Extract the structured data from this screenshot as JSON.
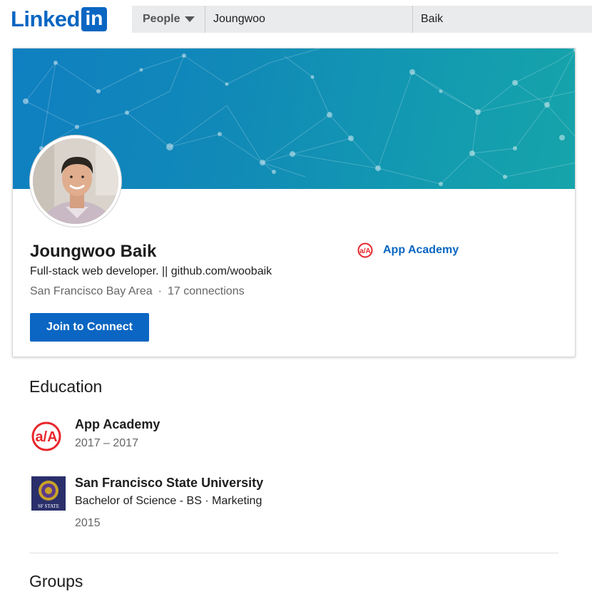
{
  "header": {
    "logo_text": "Linked",
    "logo_box_text": "in",
    "search_type": "People",
    "first_name_value": "Joungwoo",
    "last_name_value": "Baik"
  },
  "profile": {
    "name": "Joungwoo Baik",
    "headline": "Full-stack web developer. || github.com/woobaik",
    "location": "San Francisco Bay Area",
    "separator": "·",
    "connections": "17 connections",
    "join_button": "Join to Connect",
    "current_company": "App Academy"
  },
  "education": {
    "title": "Education",
    "items": [
      {
        "school": "App Academy",
        "degree": "",
        "dates": "2017 – 2017"
      },
      {
        "school": "San Francisco State University",
        "degree": "Bachelor of Science - BS · Marketing",
        "dates": "2015"
      }
    ]
  },
  "groups": {
    "title": "Groups"
  },
  "sfsu_logo_text": "SF STATE",
  "colors": {
    "accent": "#0a66c2",
    "app_academy_red": "#e8262b"
  }
}
